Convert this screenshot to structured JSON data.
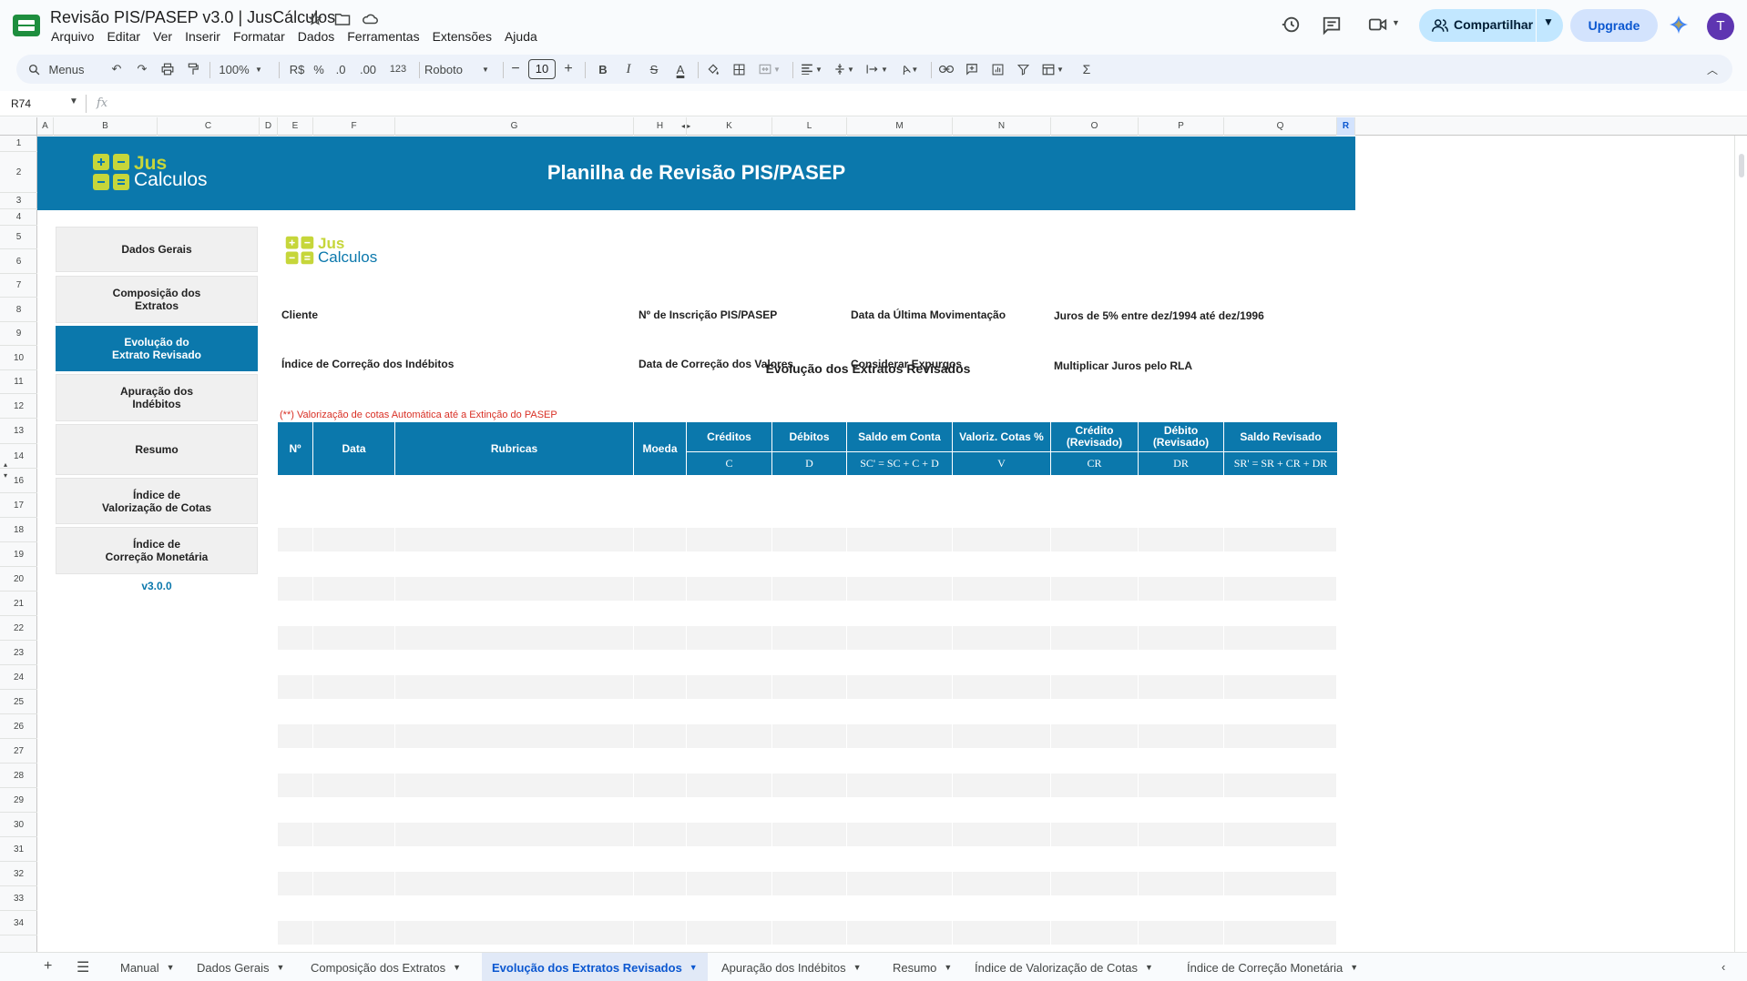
{
  "window": {
    "doc_title": "Revisão PIS/PASEP v3.0 | JusCálculos",
    "menu": [
      "Arquivo",
      "Editar",
      "Ver",
      "Inserir",
      "Formatar",
      "Dados",
      "Ferramentas",
      "Extensões",
      "Ajuda"
    ],
    "share_label": "Compartilhar",
    "upgrade_label": "Upgrade",
    "avatar_letter": "T"
  },
  "toolbar": {
    "search_label": "Menus",
    "zoom": "100%",
    "currency": "R$",
    "percent": "%",
    "dec_less": ".0",
    "dec_more": ".00",
    "number_format": "123",
    "font": "Roboto",
    "font_size": "10"
  },
  "formula_bar": {
    "cell_ref": "R74",
    "fx": "fx",
    "value": ""
  },
  "columns": [
    {
      "label": "A"
    },
    {
      "label": "B"
    },
    {
      "label": "C"
    },
    {
      "label": "D"
    },
    {
      "label": "E"
    },
    {
      "label": "F"
    },
    {
      "label": "G"
    },
    {
      "label": "H"
    },
    {
      "label": "K"
    },
    {
      "label": "L"
    },
    {
      "label": "M"
    },
    {
      "label": "N"
    },
    {
      "label": "O"
    },
    {
      "label": "P"
    },
    {
      "label": "Q"
    },
    {
      "label": "R"
    }
  ],
  "rows": [
    "1",
    "2",
    "3",
    "4",
    "5",
    "6",
    "7",
    "8",
    "9",
    "10",
    "11",
    "12",
    "13",
    "14",
    "16",
    "17",
    "18",
    "19",
    "20",
    "21",
    "22",
    "23",
    "24",
    "25",
    "26",
    "27",
    "28",
    "29",
    "30",
    "31",
    "32",
    "33",
    "34"
  ],
  "sheet": {
    "brand_top": "Jus",
    "brand_bottom": "Calculos",
    "banner_title": "Planilha de Revisão PIS/PASEP",
    "nav": [
      {
        "label": "Dados Gerais",
        "active": false
      },
      {
        "label": "Composição dos\nExtratos",
        "active": false
      },
      {
        "label": "Evolução do\nExtrato Revisado",
        "active": true
      },
      {
        "label": "Apuração dos\nIndébitos",
        "active": false
      },
      {
        "label": "Resumo",
        "active": false
      },
      {
        "label": "Índice de\nValorização de Cotas",
        "active": false
      },
      {
        "label": "Índice de\nCorreção Monetária",
        "active": false
      }
    ],
    "version": "v3.0.0",
    "section_title": "Evolução dos Extratos Revisados",
    "fields": {
      "cliente": "Cliente",
      "inscricao": "Nº de Inscrição PIS/PASEP",
      "ultima_mov": "Data da Última Movimentação",
      "juros": "Juros de 5% entre dez/1994 até dez/1996",
      "indice": "Índice de Correção dos Indébitos",
      "data_correcao": "Data de Correção dos Valores",
      "expurgos": "Considerar Expurgos",
      "multiplicar": "Multiplicar Juros pelo RLA"
    },
    "note": "(**) Valorização de cotas Automática até a Extinção do PASEP",
    "table_headers": [
      "Nº",
      "Data",
      "Rubricas",
      "Moeda",
      "Créditos",
      "Débitos",
      "Saldo em Conta",
      "Valoriz. Cotas %",
      "Crédito\n(Revisado)",
      "Débito\n(Revisado)",
      "Saldo Revisado"
    ],
    "table_subheaders": [
      "C",
      "D",
      "SC' = SC + C + D",
      "V",
      "CR",
      "DR",
      "SR' = SR + CR + DR"
    ]
  },
  "sheet_tabs": [
    {
      "label": "Manual",
      "active": false
    },
    {
      "label": "Dados Gerais",
      "active": false
    },
    {
      "label": "Composição dos Extratos",
      "active": false
    },
    {
      "label": "Evolução dos Extratos Revisados",
      "active": true
    },
    {
      "label": "Apuração dos Indébitos",
      "active": false
    },
    {
      "label": "Resumo",
      "active": false
    },
    {
      "label": "Índice de Valorização de Cotas",
      "active": false
    },
    {
      "label": "Índice de Correção Monetária",
      "active": false
    }
  ],
  "colors": {
    "brand_blue": "#0b78ac",
    "logo_green": "#c6d63a",
    "active_tab": "#0b57d0"
  }
}
